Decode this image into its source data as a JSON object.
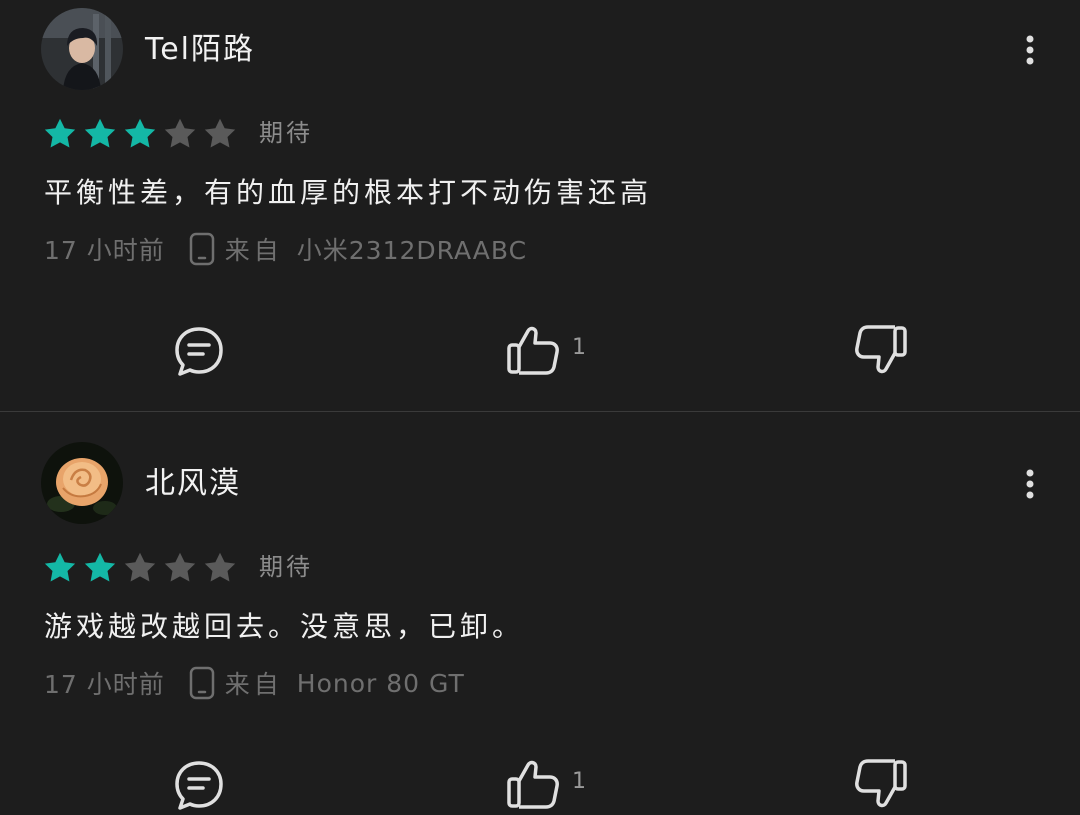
{
  "reviews": [
    {
      "username": "Tel陌路",
      "rating": 3,
      "max_rating": 5,
      "rating_label": "期待",
      "content": "平衡性差，有的血厚的根本打不动伤害还高",
      "time": "17 小时前",
      "from_label": "来自",
      "device": "小米2312DRAABC",
      "like_count": "1"
    },
    {
      "username": "北风漠",
      "rating": 2,
      "max_rating": 5,
      "rating_label": "期待",
      "content": "游戏越改越回去。没意思，已卸。",
      "time": "17 小时前",
      "from_label": "来自",
      "device": "Honor 80 GT",
      "like_count": "1"
    }
  ],
  "colors": {
    "background": "#1d1d1d",
    "star_filled": "#14b8a6",
    "star_empty": "#5a5a5a",
    "meta_text": "#6f6f6f",
    "divider": "#3a3a3a"
  },
  "icons": {
    "more": "more-vertical-icon",
    "reply": "comment-icon",
    "like": "thumbs-up-icon",
    "dislike": "thumbs-down-icon",
    "device": "phone-icon",
    "star": "star-icon"
  }
}
